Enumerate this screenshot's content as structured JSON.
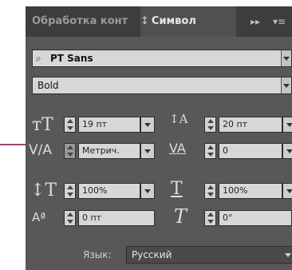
{
  "tabs": {
    "inactive": "Обработка конт",
    "active": "Символ",
    "active_prefix_icon": "↕",
    "forward_icon": "▸▸",
    "menu_icon": "▾≡"
  },
  "font": {
    "family": "PT Sans",
    "style": "Bold"
  },
  "params": {
    "font_size": "19 пт",
    "leading": "20 пт",
    "kerning": "Метрич.",
    "tracking": "0",
    "vertical_scale": "100%",
    "horizontal_scale": "100%",
    "baseline_shift": "0 пт",
    "skew": "0°"
  },
  "language": {
    "label": "Язык:",
    "value": "Русский"
  },
  "colors": {
    "panel_bg": "#585858",
    "tab_bg": "#3d3d3d",
    "field_bg": "#d7d7d7",
    "pointer_line": "#b8357a"
  }
}
